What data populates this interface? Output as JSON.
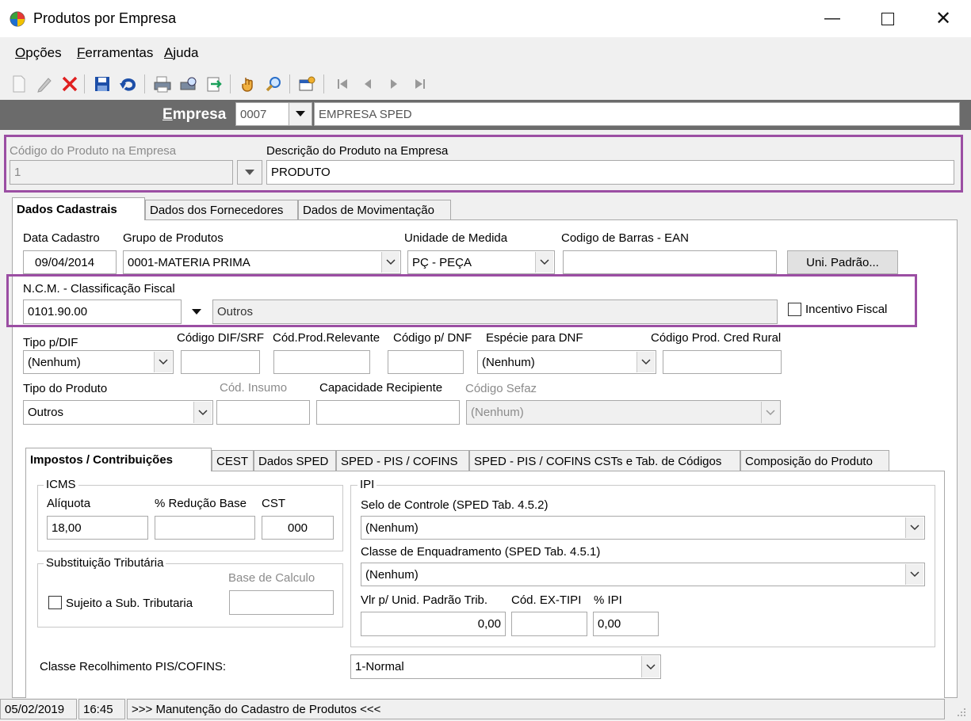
{
  "window": {
    "title": "Produtos por Empresa"
  },
  "menu": [
    {
      "label": "Opções",
      "accel": "O",
      "rest": "pções"
    },
    {
      "label": "Ferramentas",
      "accel": "F",
      "rest": "erramentas"
    },
    {
      "label": "Ajuda",
      "accel": "A",
      "rest": "juda"
    }
  ],
  "empresa": {
    "label_accel": "E",
    "label_rest": "mpresa",
    "code": "0007",
    "name": "EMPRESA SPED"
  },
  "produto": {
    "codigo_label": "Código do Produto na Empresa",
    "codigo_value": "1",
    "descricao_label": "Descrição do Produto na Empresa",
    "descricao_value": "PRODUTO"
  },
  "tabs_main": [
    "Dados Cadastrais",
    "Dados dos Fornecedores",
    "Dados de Movimentação"
  ],
  "cadastro": {
    "data_label": "Data Cadastro",
    "data_value": "09/04/2014",
    "grupo_label": "Grupo de Produtos",
    "grupo_value": "0001-MATERIA PRIMA",
    "unidade_label": "Unidade de Medida",
    "unidade_value": "PÇ - PEÇA",
    "ean_label": "Codigo de Barras - EAN",
    "ean_value": "",
    "uni_padrao_button": "Uni. Padrão...",
    "ncm_label": "N.C.M. -  Classificação Fiscal",
    "ncm_value": "0101.90.00",
    "ncm_desc": "Outros",
    "incentivo_label": "Incentivo Fiscal",
    "tipo_dif_label": "Tipo p/DIF",
    "tipo_dif_value": "(Nenhum)",
    "codigo_dif_label": "Código DIF/SRF",
    "cod_prod_rel_label": "Cód.Prod.Relevante",
    "codigo_dnf_label": "Código p/ DNF",
    "especie_dnf_label": "Espécie para DNF",
    "especie_dnf_value": "(Nenhum)",
    "cred_rural_label": "Código Prod. Cred Rural",
    "tipo_produto_label": "Tipo do Produto",
    "tipo_produto_value": "Outros",
    "cod_insumo_label": "Cód. Insumo",
    "capacidade_label": "Capacidade Recipiente",
    "sefaz_label": "Código Sefaz",
    "sefaz_value": "(Nenhum)"
  },
  "tabs_impostos": [
    "Impostos / Contribuições",
    "CEST",
    "Dados SPED",
    "SPED - PIS / COFINS",
    "SPED - PIS / COFINS CSTs e Tab. de Códigos",
    "Composição do Produto"
  ],
  "icms": {
    "title": "ICMS",
    "aliquota_label": "Alíquota",
    "aliquota_value": "18,00",
    "reducao_label": "% Redução Base",
    "reducao_value": "",
    "cst_label": "CST",
    "cst_value": "000"
  },
  "st": {
    "title": "Substituição Tributária",
    "base_label": "Base de Calculo",
    "sujeito_label": "Sujeito a Sub. Tributaria"
  },
  "ipi": {
    "title": "IPI",
    "selo_label": "Selo de Controle (SPED Tab. 4.5.2)",
    "selo_value": "(Nenhum)",
    "classe_label": "Classe de Enquadramento (SPED Tab. 4.5.1)",
    "classe_value": "(Nenhum)",
    "vlr_label": "Vlr p/ Unid. Padrão Trib.",
    "vlr_value": "0,00",
    "ex_tipi_label": "Cód. EX-TIPI",
    "ex_tipi_value": "",
    "pct_label": "% IPI",
    "pct_value": "0,00"
  },
  "pis": {
    "label": "Classe Recolhimento PIS/COFINS:",
    "value": "1-Normal"
  },
  "status": {
    "date": "05/02/2019",
    "time": "16:45",
    "message": ">>> Manutenção do Cadastro de Produtos <<<"
  }
}
